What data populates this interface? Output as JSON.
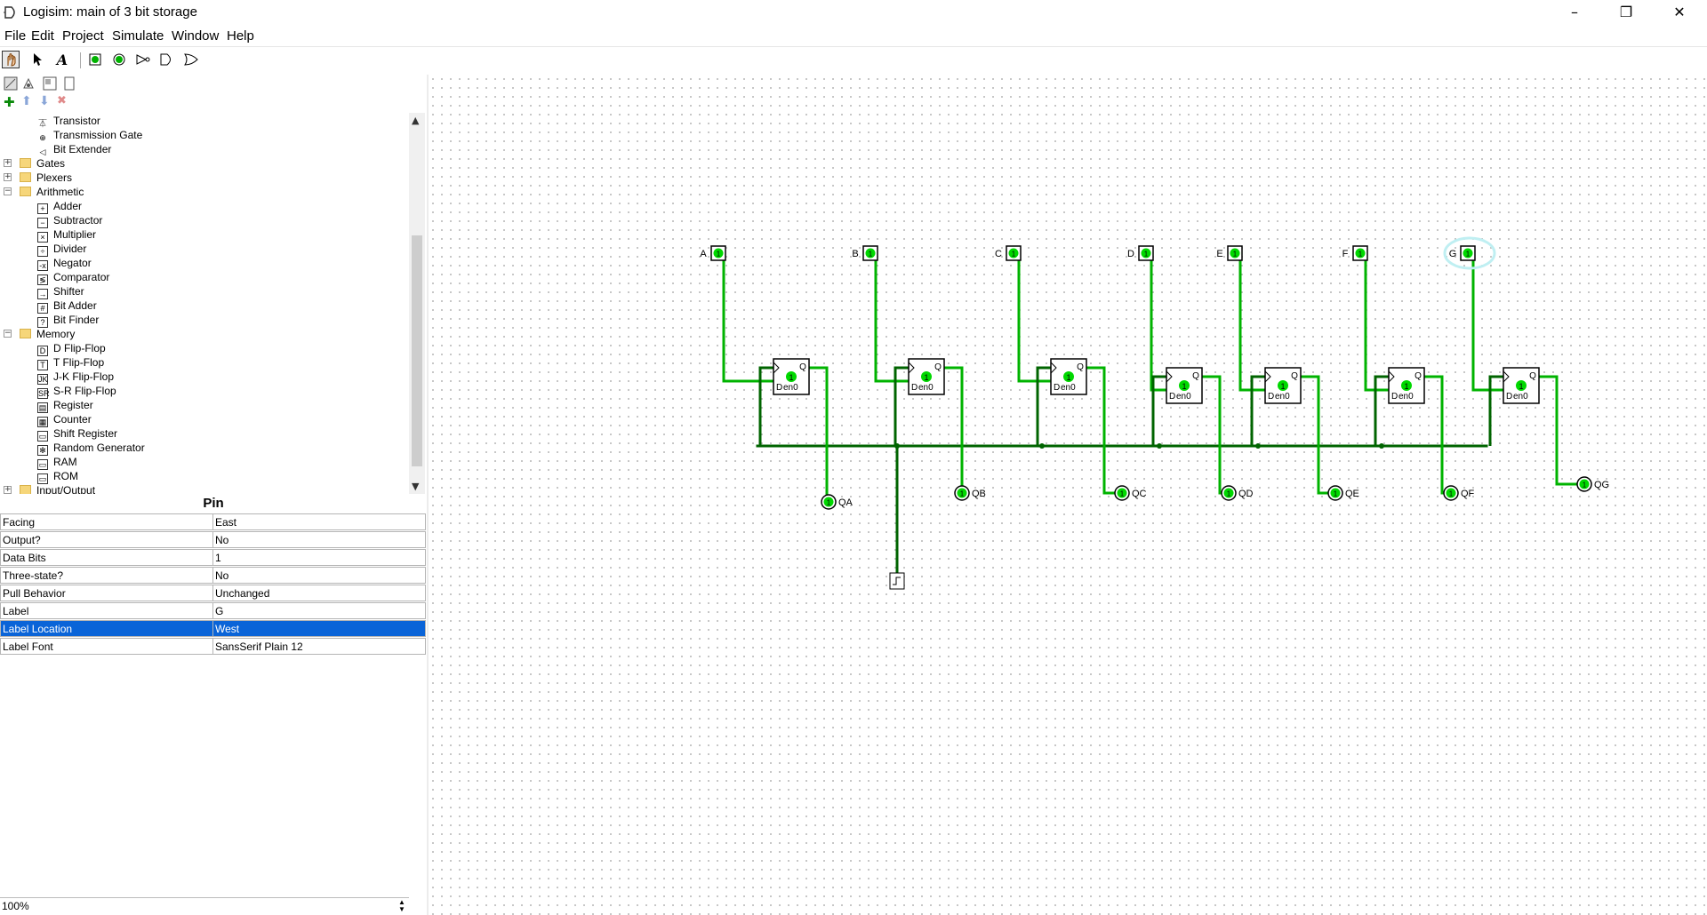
{
  "window": {
    "title": "Logisim: main of 3 bit storage",
    "minimize": "–",
    "maximize": "❐",
    "close": "✕"
  },
  "menu": [
    "File",
    "Edit",
    "Project",
    "Simulate",
    "Window",
    "Help"
  ],
  "toolbar": [
    "poke-tool",
    "select-tool",
    "text-tool",
    "input-pin",
    "output-pin",
    "not-gate",
    "and-gate",
    "or-gate"
  ],
  "tree": {
    "items": [
      {
        "label": "Transistor",
        "icon": "transistor-icon",
        "type": "tool",
        "sym": "⏄"
      },
      {
        "label": "Transmission Gate",
        "icon": "transmission-gate-icon",
        "type": "tool",
        "sym": "⊕"
      },
      {
        "label": "Bit Extender",
        "icon": "bit-extender-icon",
        "type": "tool",
        "sym": "◁"
      },
      {
        "label": "Gates",
        "type": "folder",
        "expanded": false
      },
      {
        "label": "Plexers",
        "type": "folder",
        "expanded": false
      },
      {
        "label": "Arithmetic",
        "type": "folder",
        "expanded": true
      },
      {
        "label": "Adder",
        "icon": "adder-icon",
        "type": "tool",
        "sym": "+"
      },
      {
        "label": "Subtractor",
        "icon": "subtractor-icon",
        "type": "tool",
        "sym": "−"
      },
      {
        "label": "Multiplier",
        "icon": "multiplier-icon",
        "type": "tool",
        "sym": "×"
      },
      {
        "label": "Divider",
        "icon": "divider-icon",
        "type": "tool",
        "sym": "÷"
      },
      {
        "label": "Negator",
        "icon": "negator-icon",
        "type": "tool",
        "sym": "-x"
      },
      {
        "label": "Comparator",
        "icon": "comparator-icon",
        "type": "tool",
        "sym": "≶"
      },
      {
        "label": "Shifter",
        "icon": "shifter-icon",
        "type": "tool",
        "sym": "→"
      },
      {
        "label": "Bit Adder",
        "icon": "bit-adder-icon",
        "type": "tool",
        "sym": "#"
      },
      {
        "label": "Bit Finder",
        "icon": "bit-finder-icon",
        "type": "tool",
        "sym": "?"
      },
      {
        "label": "Memory",
        "type": "folder",
        "expanded": true
      },
      {
        "label": "D Flip-Flop",
        "icon": "d-flip-flop-icon",
        "type": "tool",
        "sym": "D"
      },
      {
        "label": "T Flip-Flop",
        "icon": "t-flip-flop-icon",
        "type": "tool",
        "sym": "T"
      },
      {
        "label": "J-K Flip-Flop",
        "icon": "jk-flip-flop-icon",
        "type": "tool",
        "sym": "JK"
      },
      {
        "label": "S-R Flip-Flop",
        "icon": "sr-flip-flop-icon",
        "type": "tool",
        "sym": "SR"
      },
      {
        "label": "Register",
        "icon": "register-icon",
        "type": "tool",
        "sym": "▤"
      },
      {
        "label": "Counter",
        "icon": "counter-icon",
        "type": "tool",
        "sym": "▦"
      },
      {
        "label": "Shift Register",
        "icon": "shift-register-icon",
        "type": "tool",
        "sym": "▭"
      },
      {
        "label": "Random Generator",
        "icon": "random-generator-icon",
        "type": "tool",
        "sym": "✻"
      },
      {
        "label": "RAM",
        "icon": "ram-icon",
        "type": "tool",
        "sym": "▭"
      },
      {
        "label": "ROM",
        "icon": "rom-icon",
        "type": "tool",
        "sym": "▭"
      },
      {
        "label": "Input/Output",
        "type": "folder",
        "expanded": false
      }
    ]
  },
  "properties": {
    "title": "Pin",
    "rows": [
      {
        "key": "Facing",
        "value": "East"
      },
      {
        "key": "Output?",
        "value": "No"
      },
      {
        "key": "Data Bits",
        "value": "1"
      },
      {
        "key": "Three-state?",
        "value": "No"
      },
      {
        "key": "Pull Behavior",
        "value": "Unchanged"
      },
      {
        "key": "Label",
        "value": "G"
      },
      {
        "key": "Label Location",
        "value": "West",
        "selected": true
      },
      {
        "key": "Label Font",
        "value": "SansSerif Plain 12"
      }
    ]
  },
  "zoom": "100%",
  "circuit": {
    "wire_color": "#00b300",
    "wire_dark": "#006400",
    "inputs": [
      "A",
      "B",
      "C",
      "D",
      "E",
      "F",
      "G"
    ],
    "outputs": [
      "QA",
      "QB",
      "QC",
      "QD",
      "QE",
      "QF",
      "QG"
    ],
    "pin_value": "1",
    "ff_q_label": "Q",
    "ff_d_label": "D",
    "ff_en_label": "en",
    "ff_value": "1",
    "ff_d_value": "0"
  }
}
